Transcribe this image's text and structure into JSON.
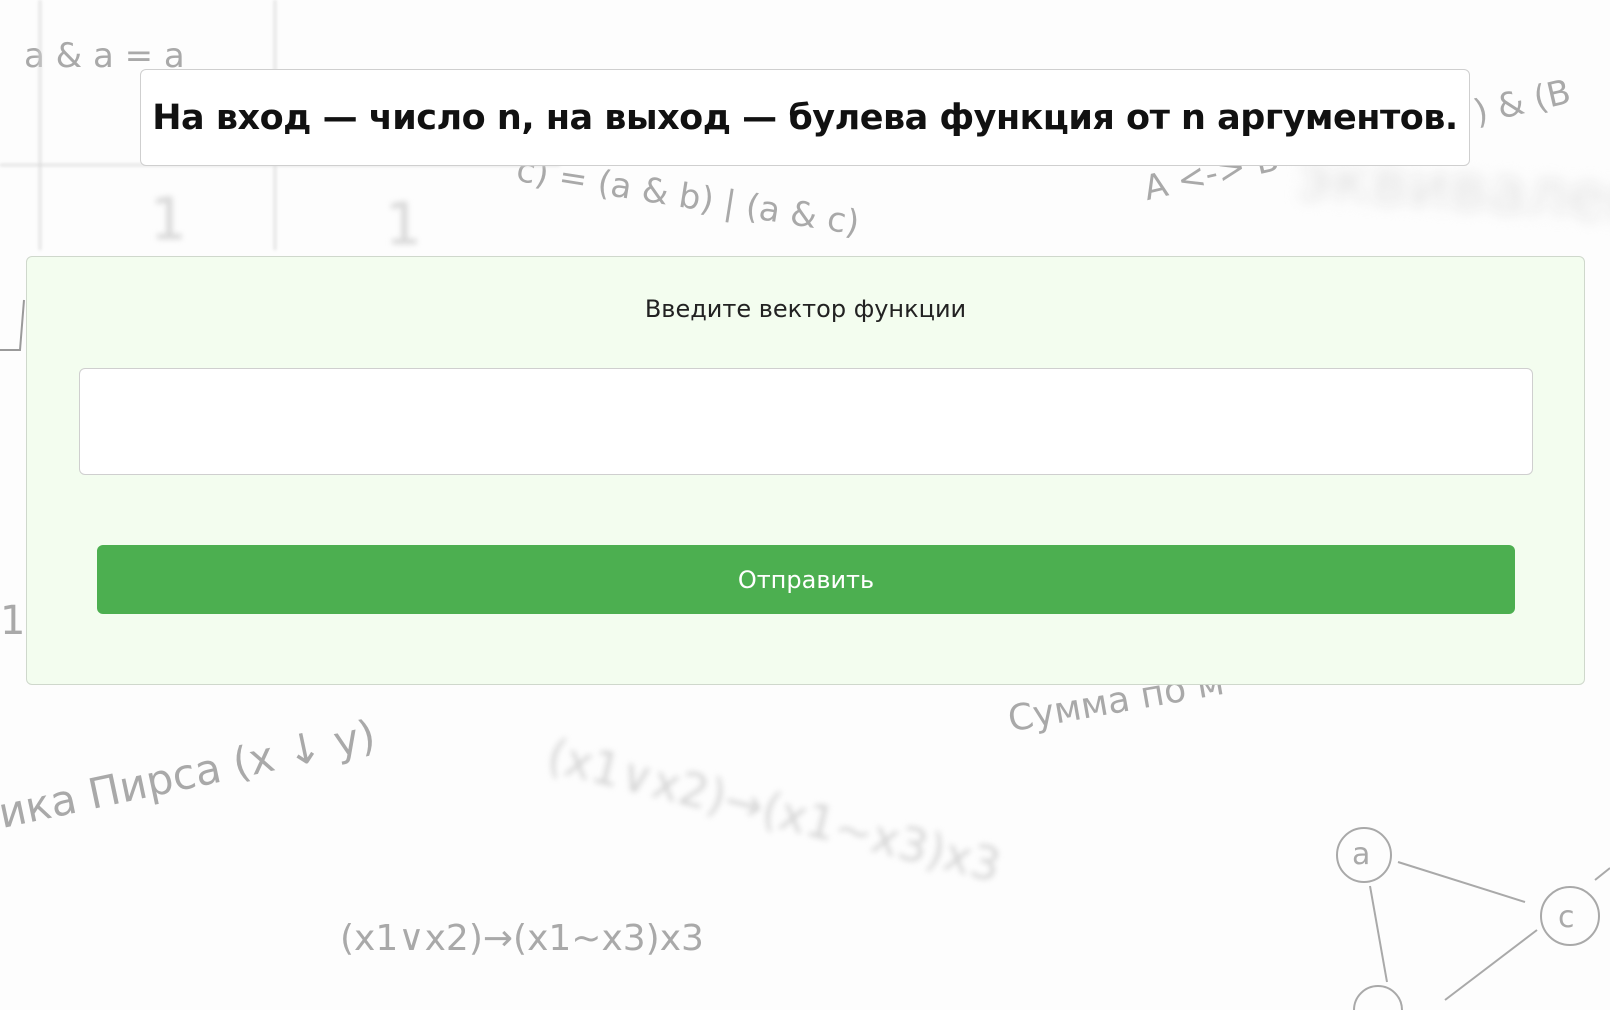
{
  "header": {
    "title": "На вход — число n, на выход — булева функция от n аргументов."
  },
  "form": {
    "label": "Введите вектор функции",
    "input_value": "",
    "submit_label": "Отправить"
  },
  "background": {
    "formulas": [
      "a & a = a",
      "c) = (a & b) | (a & c)",
      "A <-> B",
      "эквивален",
      ") & (B",
      "1",
      "1",
      "1",
      "Сумма по м",
      "ика Пирса (x ↓ y)",
      "(x1∨x2)→(x1~x3)x3",
      "(x1∨x2)→(x1~x3)x3"
    ],
    "graph_nodes": [
      "a",
      "c"
    ]
  },
  "colors": {
    "accent": "#4caf50",
    "panel_background": "#f3fdef",
    "doodle": "#a9a9a9"
  }
}
